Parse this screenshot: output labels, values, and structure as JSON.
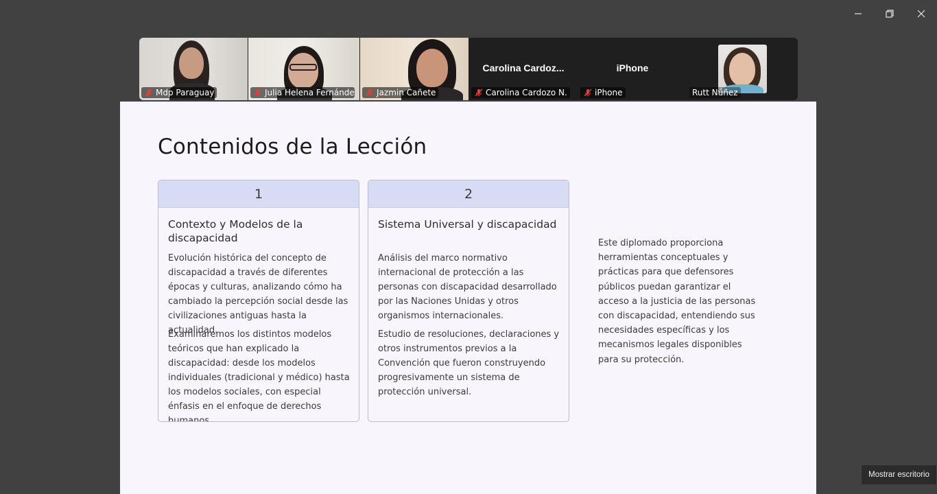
{
  "participants": [
    {
      "name": "Mdp Paraguay",
      "muted": true,
      "video": true
    },
    {
      "name": "Julia Helena Fernández ...",
      "muted": true,
      "video": true,
      "speaking": true
    },
    {
      "name": "Jazmin Cañete",
      "muted": true,
      "video": true
    },
    {
      "name": "Carolina Cardozo N.",
      "display_name": "Carolina  Cardoz...",
      "muted": true,
      "video": false
    },
    {
      "name": "iPhone",
      "display_name": "iPhone",
      "muted": true,
      "video": false
    },
    {
      "name": "Rutt Núñez",
      "muted": false,
      "video": true
    }
  ],
  "slide": {
    "title": "Contenidos de la Lección",
    "cards": [
      {
        "number": "1",
        "heading": "Contexto y Modelos de la discapacidad",
        "para1": "Evolución histórica del concepto de discapacidad a través de diferentes épocas y culturas, analizando cómo ha cambiado la percepción social desde las civilizaciones antiguas hasta la actualidad.",
        "para2": "Examinaremos los distintos modelos teóricos que han explicado la discapacidad: desde los modelos individuales (tradicional y médico) hasta los modelos sociales, con especial énfasis en el enfoque de derechos humanos."
      },
      {
        "number": "2",
        "heading": "Sistema Universal y discapacidad",
        "para1": "Análisis del marco normativo internacional de protección a las personas con discapacidad desarrollado por las Naciones Unidas y otros organismos internacionales.",
        "para2": "Estudio de resoluciones, declaraciones y otros instrumentos previos a la Convención que fueron construyendo progresivamente un sistema de protección universal."
      }
    ],
    "side_text": "Este diplomado proporciona herramientas conceptuales y prácticas para que defensores públicos puedan garantizar el acceso a la justicia de las personas con discapacidad, entendiendo sus necesidades específicas y los mecanismos legales disponibles para su protección."
  },
  "tooltip": "Mostrar escritorio",
  "colors": {
    "background": "#414141",
    "active_speaker": "#2bd48c",
    "card_header": "#d7dcf4",
    "slide_bg": "#f8f6fc"
  },
  "icons": [
    "minimize-icon",
    "restore-icon",
    "close-icon",
    "mic-muted-icon"
  ]
}
